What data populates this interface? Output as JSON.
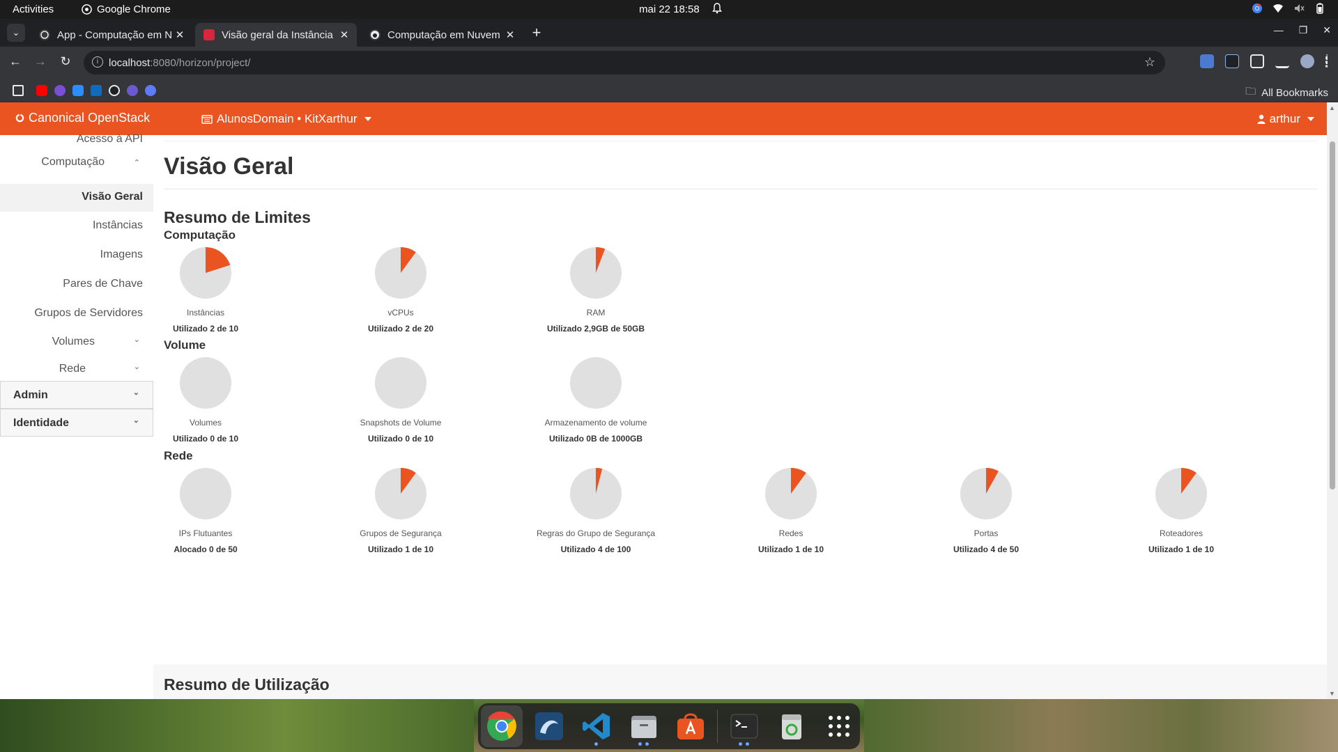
{
  "system_bar": {
    "activities": "Activities",
    "app_name": "Google Chrome",
    "clock": "mai 22  18:58"
  },
  "browser": {
    "tabs": [
      {
        "title": "App - Computação em N",
        "active": false
      },
      {
        "title": "Visão geral da Instância",
        "active": true
      },
      {
        "title": "Computação em Nuvem",
        "active": false
      }
    ],
    "url_host": "localhost",
    "url_path": ":8080/horizon/project/",
    "all_bookmarks": "All Bookmarks"
  },
  "navbar": {
    "brand": "Canonical OpenStack",
    "project": "AlunosDomain • KitXarthur",
    "user": "arthur",
    "color": "#e95420"
  },
  "sidebar": {
    "items": [
      {
        "label": "Acesso à API"
      },
      {
        "label": "Computação"
      },
      {
        "label": "Visão Geral"
      },
      {
        "label": "Instâncias"
      },
      {
        "label": "Imagens"
      },
      {
        "label": "Pares de Chave"
      },
      {
        "label": "Grupos de Servidores"
      },
      {
        "label": "Volumes"
      },
      {
        "label": "Rede"
      }
    ],
    "groups": [
      {
        "label": "Admin"
      },
      {
        "label": "Identidade"
      }
    ]
  },
  "main": {
    "page_title": "Visão Geral",
    "limits_title": "Resumo de Limites",
    "usage_title": "Resumo de Utilização",
    "sections": [
      {
        "title": "Computação",
        "charts": [
          {
            "label": "Instâncias",
            "usage": "Utilizado 2 de 10",
            "used": 2,
            "total": 10
          },
          {
            "label": "vCPUs",
            "usage": "Utilizado 2 de 20",
            "used": 2,
            "total": 20
          },
          {
            "label": "RAM",
            "usage": "Utilizado 2,9GB de 50GB",
            "used": 2.9,
            "total": 50
          }
        ]
      },
      {
        "title": "Volume",
        "charts": [
          {
            "label": "Volumes",
            "usage": "Utilizado 0 de 10",
            "used": 0,
            "total": 10
          },
          {
            "label": "Snapshots de Volume",
            "usage": "Utilizado 0 de 10",
            "used": 0,
            "total": 10
          },
          {
            "label": "Armazenamento de volume",
            "usage": "Utilizado 0B de 1000GB",
            "used": 0,
            "total": 1000
          }
        ]
      },
      {
        "title": "Rede",
        "charts": [
          {
            "label": "IPs Flutuantes",
            "usage": "Alocado 0 de 50",
            "used": 0,
            "total": 50
          },
          {
            "label": "Grupos de Segurança",
            "usage": "Utilizado 1 de 10",
            "used": 1,
            "total": 10
          },
          {
            "label": "Regras do Grupo de Segurança",
            "usage": "Utilizado 4 de 100",
            "used": 4,
            "total": 100
          },
          {
            "label": "Redes",
            "usage": "Utilizado 1 de 10",
            "used": 1,
            "total": 10
          },
          {
            "label": "Portas",
            "usage": "Utilizado 4 de 50",
            "used": 4,
            "total": 50
          },
          {
            "label": "Roteadores",
            "usage": "Utilizado 1 de 10",
            "used": 1,
            "total": 10
          }
        ]
      }
    ]
  },
  "chart_data": {
    "type": "pie",
    "colors": {
      "used": "#e95420",
      "free": "#e0e0e0"
    }
  },
  "dock": {
    "apps": [
      "chrome-icon",
      "mysql-workbench-icon",
      "vscode-icon",
      "files-icon",
      "app-center-icon",
      "terminal-icon",
      "trash-icon",
      "app-grid-icon"
    ]
  }
}
